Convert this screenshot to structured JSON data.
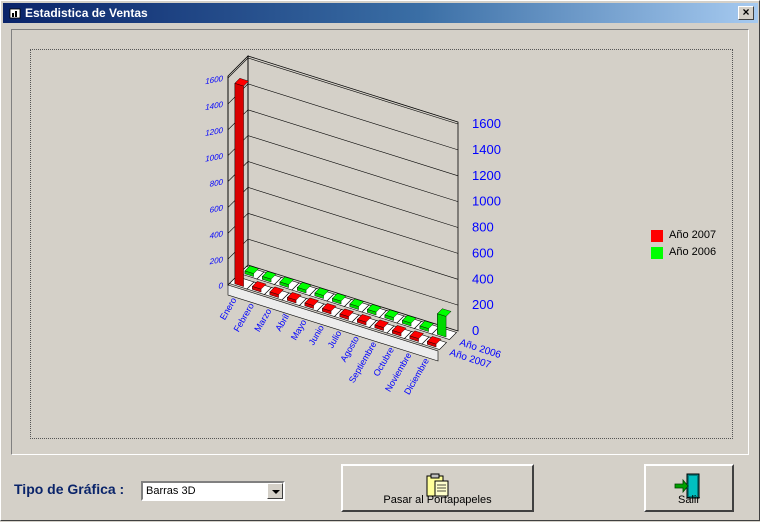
{
  "window": {
    "title": "Estadistica de Ventas",
    "close": "×"
  },
  "controls": {
    "tipo_label": "Tipo de Gráfica :",
    "tipo_value": "Barras 3D",
    "portapapeles_label": "Pasar al Portapapeles",
    "salir_label": "Salir"
  },
  "chart_data": {
    "type": "bar",
    "style": "3d",
    "categories": [
      "Enero",
      "Febrero",
      "Marzo",
      "Abril",
      "Mayo",
      "Junio",
      "Julio",
      "Agosto",
      "Septiembre",
      "Octubre",
      "Noviembre",
      "Diciembre"
    ],
    "series": [
      {
        "name": "Año 2007",
        "color": "#ff0000",
        "values": [
          1550,
          0,
          0,
          0,
          0,
          0,
          0,
          0,
          0,
          0,
          0,
          0
        ]
      },
      {
        "name": "Año 2006",
        "color": "#00ff00",
        "values": [
          0,
          0,
          0,
          0,
          0,
          0,
          0,
          0,
          0,
          0,
          0,
          160
        ]
      }
    ],
    "series_axis_labels": [
      "Año 2007",
      "Año 2006"
    ],
    "right_ticks": [
      "0",
      "200",
      "400",
      "600",
      "800",
      "1000",
      "1200",
      "1400",
      "1600"
    ],
    "left_ticks": [
      "0",
      "200",
      "400",
      "600",
      "800",
      "1000",
      "1200",
      "1400",
      "1600"
    ],
    "ylim": [
      0,
      1600
    ],
    "legend_position": "right",
    "grid": true
  }
}
